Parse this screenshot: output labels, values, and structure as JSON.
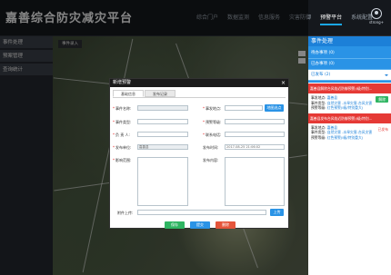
{
  "header": {
    "app_title": "嘉善综合防灾减灾平台",
    "nav": [
      {
        "label": "综合门户",
        "active": false
      },
      {
        "label": "数据监测",
        "active": false
      },
      {
        "label": "信息服务",
        "active": false
      },
      {
        "label": "灾害防御",
        "active": false
      },
      {
        "label": "预警平台",
        "active": true
      },
      {
        "label": "系统配置",
        "active": false
      }
    ],
    "user_name": "strong+"
  },
  "sidebar": {
    "items": [
      {
        "label": "事件处理"
      },
      {
        "label": "预案管理"
      },
      {
        "label": "查询统计"
      }
    ]
  },
  "map": {
    "chip_label": "事件录入"
  },
  "modal": {
    "title": "新增预警",
    "close_glyph": "×",
    "tabs": [
      "基础信息",
      "发布记录"
    ],
    "fields": {
      "event_name_label": "事件名称:",
      "event_type_label": "事件类型:",
      "responsible_label": "负  责  人:",
      "publish_org_label": "发布单位:",
      "publish_org_value": "嘉善县",
      "event_location_label": "事发地点:",
      "warning_level_label": "预警等级:",
      "contact_phone_label": "联系电话:",
      "publish_time_label": "发布时间:",
      "publish_time_value": "2017-08-25 21:06:02",
      "impact_scope_label": "影响范围:",
      "publish_content_label": "发布内容:",
      "attachment_label": "附件上传:"
    },
    "buttons": {
      "locate": "地图选点",
      "upload": "上传",
      "save": "保存",
      "submit": "提交",
      "delete": "删除"
    }
  },
  "right_panel": {
    "title": "事件处理",
    "tabs": [
      {
        "label": "待办事项",
        "count": "(0)"
      },
      {
        "label": "已办事项",
        "count": "(0)"
      },
      {
        "label": "已发布",
        "count": "(2)"
      }
    ],
    "cards": [
      {
        "strip": "嘉善县解除台风临近防御预警(I级/特别…",
        "location_k": "事发地点:",
        "location_v": "嘉善县",
        "type_k": "事件类型:",
        "type_v": "自然灾害 -水旱灾害-台风灾害",
        "level_k": "预警等级:",
        "level_v": "红色预警(I级/特别重大)",
        "badge": "解除",
        "note": ""
      },
      {
        "strip": "嘉善县发布台风临近防御预警(I级/特别…",
        "location_k": "事发地点:",
        "location_v": "嘉善县",
        "type_k": "事件类型:",
        "type_v": "自然灾害 -水旱灾害-台风灾害",
        "level_k": "预警等级:",
        "level_v": "红色预警(I级/特别重大)",
        "badge": "",
        "note": "已发布"
      }
    ]
  }
}
